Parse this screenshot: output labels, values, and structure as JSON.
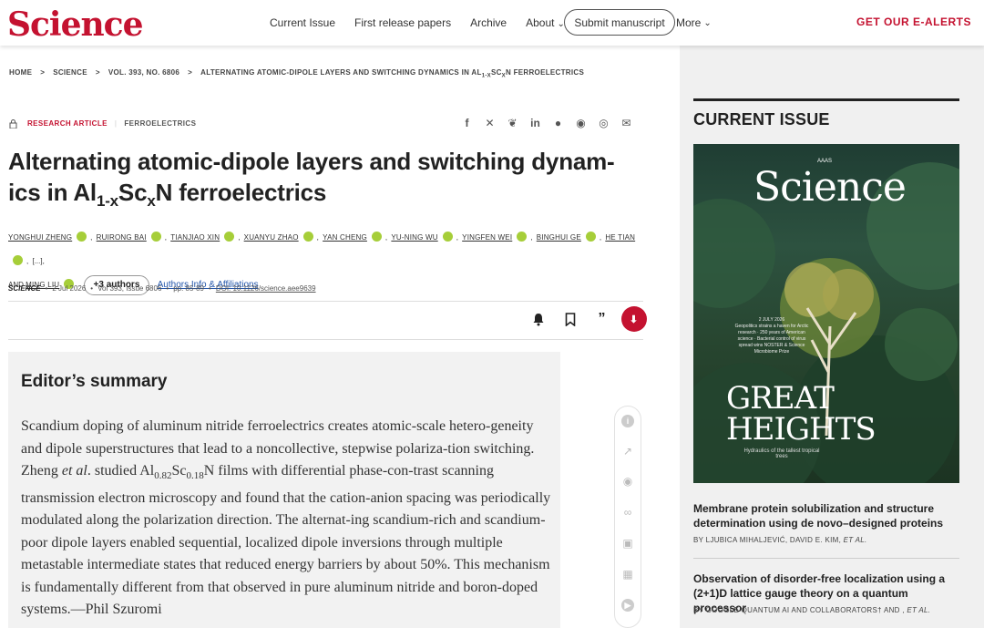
{
  "header": {
    "logo": "Science",
    "nav": [
      "Current Issue",
      "First release papers",
      "Archive",
      "About"
    ],
    "submit": "Submit manuscript",
    "more": "More",
    "alerts": "GET OUR E-ALERTS"
  },
  "breadcrumb": {
    "home": "HOME",
    "journal": "SCIENCE",
    "volume": "VOL. 393, NO. 6806",
    "article_pre": "ALTERNATING ATOMIC-DIPOLE LAYERS AND SWITCHING DYNAMICS IN AL",
    "article_sub": "1-X",
    "article_mid": "SC",
    "article_sub2": "X",
    "article_post": "N FERROELECTRICS"
  },
  "article": {
    "type": "RESEARCH ARTICLE",
    "subject": "FERROELECTRICS",
    "title_1": "Alternating atomic-dipole layers and switching dynam-",
    "title_2a": "ics in Al",
    "title_sub1": "1-x",
    "title_2b": "Sc",
    "title_sub2": "x",
    "title_2c": "N ferroelectrics",
    "authors": [
      "YONGHUI ZHENG",
      "RUIRONG BAI",
      "TIANJIAO XIN",
      "XUANYU ZHAO",
      "YAN CHENG",
      "YU-NING WU",
      "YINGFEN WEI",
      "BINGHUI GE",
      "HE TIAN"
    ],
    "authors_ellipsis": "[...]",
    "last_author_prefix": "AND",
    "last_author": "MING LIU",
    "more_authors": "+3 authors",
    "affiliations": "Authors Info & Affiliations",
    "meta": {
      "journal": "SCIENCE",
      "date": "2 Jul 2026",
      "issue": "Vol 393, Issue 6806",
      "pages": "pp. 85-89",
      "doi": "DOI: 10.1126/science.aee9639"
    }
  },
  "share_icons": [
    "facebook-icon",
    "x-icon",
    "bluesky-icon",
    "linkedin-icon",
    "reddit-icon",
    "wechat-icon",
    "whatsapp-icon",
    "email-icon"
  ],
  "summary": {
    "heading": "Editor’s summary",
    "text_1": "Scandium doping of aluminum nitride ferroelectrics creates atomic-scale hetero-geneity and dipole superstructures that lead to a noncollective, stepwise polariza-tion switching. Zheng ",
    "etal": "et al",
    "text_2": ". studied Al",
    "sub_a": "0.82",
    "text_3": "Sc",
    "sub_b": "0.18",
    "text_4": "N films with differential phase-con-trast scanning transmission electron microscopy and found that the cation-anion spacing was periodically modulated along the polarization direction. The alternat-ing scandium-rich and scandium-poor dipole layers enabled sequential, localized dipole inversions through multiple metastable intermediate states that reduced energy barriers by about 50%. This mechanism is fundamentally different from that observed in pure aluminum nitride and boron-doped systems.—Phil Szuromi"
  },
  "current_issue": {
    "heading": "CURRENT ISSUE",
    "cover": {
      "logo": "Science",
      "aaas": "AAAS",
      "date": "2 JULY 2026",
      "blurb": "Geopolitics strains a haven for Arctic research · 250 years of American science · Bacterial control of virus spread wins NOSTER & Science Microbiome Prize",
      "headline_1": "GREAT",
      "headline_2": "HEIGHTS",
      "sub": "Hydraulics of the tallest tropical trees"
    },
    "items": [
      {
        "title": "Membrane protein solubilization and structure determination using de novo–designed proteins",
        "authors_pre": "BY LJUBICA MIHALJEVIĆ,  DAVID E. KIM, ",
        "authors_etal": "ET AL."
      },
      {
        "title": "Observation of disorder-free localization using a (2+1)D lattice gauge theory on a quantum processor",
        "authors_pre": "BY GOOGLE QUANTUM AI AND COLLABORATORS† AND , ",
        "authors_etal": "ET AL."
      }
    ]
  },
  "colors": {
    "brand": "#c41230",
    "link": "#2255aa",
    "orcid": "#a6ce39"
  }
}
